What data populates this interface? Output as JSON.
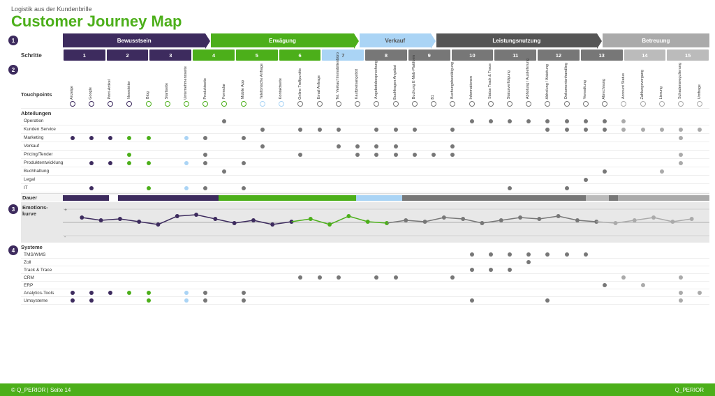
{
  "header": {
    "subtitle": "Logistik aus der Kundenbrille",
    "title": "Customer Journey Map"
  },
  "phases": [
    {
      "label": "Bewusstsein",
      "class": "phase-bewusstsein",
      "flex": 4
    },
    {
      "label": "Erwägung",
      "class": "phase-erwagung",
      "flex": 4
    },
    {
      "label": "Verkauf",
      "class": "phase-verkauf",
      "flex": 2
    },
    {
      "label": "Leistungsnutzung",
      "class": "phase-leistung",
      "flex": 4
    },
    {
      "label": "Betreuung",
      "class": "phase-betreuung",
      "flex": 3
    }
  ],
  "steps": [
    {
      "num": "1",
      "class": "step-dark"
    },
    {
      "num": "2",
      "class": "step-dark"
    },
    {
      "num": "3",
      "class": "step-dark"
    },
    {
      "num": "4",
      "class": "step-green"
    },
    {
      "num": "5",
      "class": "step-green"
    },
    {
      "num": "6",
      "class": "step-green"
    },
    {
      "num": "7",
      "class": "step-lightblue"
    },
    {
      "num": "8",
      "class": "step-gray"
    },
    {
      "num": "9",
      "class": "step-gray"
    },
    {
      "num": "10",
      "class": "step-gray"
    },
    {
      "num": "11",
      "class": "step-gray"
    },
    {
      "num": "12",
      "class": "step-gray"
    },
    {
      "num": "13",
      "class": "step-gray"
    },
    {
      "num": "14",
      "class": "step-lightgray"
    },
    {
      "num": "15",
      "class": "step-lightgray"
    }
  ],
  "touchpoints": [
    "Anzeige",
    "Google",
    "Print-Artikel",
    "Newsletter",
    "Blog",
    "Startseite",
    "Unternehmensseite",
    "Produktseite",
    "Formular",
    "Mobile App",
    "Telefonische Anfrage",
    "Kontaktseite",
    "Online Treffpunkte",
    "Email Anfrage",
    "Tel. Verkauf Immobilienbüro",
    "Kaufpreisangebot",
    "Angebotsbesprechung",
    "Buchfragen Angebot",
    "Buchung E-Mob-Plattform",
    "B1",
    "Buchungsbestätigung",
    "Informationen",
    "Status Track & Trace",
    "Statusverfolgung",
    "Abholung / Auslieferung",
    "Abholung / Ableitung",
    "Dokumentenhandling",
    "Verwaltung",
    "Abrechnung",
    "Account Status",
    "Zahlungsvorgang",
    "Lierung",
    "Schadensregulierung",
    "Umfrage"
  ],
  "abteilungen": [
    {
      "label": "Operation",
      "dots": [
        0,
        0,
        0,
        0,
        0,
        0,
        0,
        0,
        1,
        0,
        0,
        0,
        0,
        0,
        0,
        0,
        0,
        0,
        0,
        0,
        0,
        1,
        1,
        1,
        1,
        1,
        1,
        1,
        1,
        1,
        0,
        0,
        0,
        0
      ],
      "color": "green"
    },
    {
      "label": "Kunden Service",
      "dots": [
        0,
        0,
        0,
        0,
        0,
        0,
        0,
        0,
        0,
        0,
        1,
        0,
        1,
        1,
        1,
        0,
        1,
        1,
        1,
        0,
        1,
        0,
        0,
        0,
        0,
        1,
        1,
        1,
        1,
        1,
        1,
        1,
        1,
        1
      ],
      "color": "blue"
    },
    {
      "label": "Marketing",
      "dots": [
        1,
        1,
        1,
        1,
        1,
        0,
        1,
        1,
        0,
        1,
        0,
        0,
        0,
        0,
        0,
        0,
        0,
        0,
        0,
        0,
        0,
        0,
        0,
        0,
        0,
        0,
        0,
        0,
        0,
        0,
        0,
        0,
        1,
        0
      ],
      "color": "dark"
    },
    {
      "label": "Verkauf",
      "dots": [
        0,
        0,
        0,
        0,
        0,
        0,
        0,
        0,
        0,
        0,
        1,
        0,
        0,
        0,
        1,
        1,
        1,
        1,
        0,
        0,
        1,
        0,
        0,
        0,
        0,
        0,
        0,
        0,
        0,
        0,
        0,
        0,
        0,
        0
      ],
      "color": "green"
    },
    {
      "label": "Pricing/Tender",
      "dots": [
        0,
        0,
        0,
        1,
        0,
        0,
        0,
        1,
        0,
        0,
        0,
        0,
        1,
        0,
        0,
        1,
        1,
        1,
        1,
        1,
        1,
        0,
        0,
        0,
        0,
        0,
        0,
        0,
        0,
        0,
        0,
        0,
        1,
        0
      ],
      "color": "blue"
    },
    {
      "label": "Produktentwicklung",
      "dots": [
        0,
        1,
        1,
        1,
        1,
        0,
        1,
        1,
        0,
        1,
        0,
        0,
        0,
        0,
        0,
        0,
        0,
        0,
        0,
        0,
        0,
        0,
        0,
        0,
        0,
        0,
        0,
        0,
        0,
        0,
        0,
        0,
        1,
        0
      ],
      "color": "dark"
    },
    {
      "label": "Buchhaltung",
      "dots": [
        0,
        0,
        0,
        0,
        0,
        0,
        0,
        0,
        1,
        0,
        0,
        0,
        0,
        0,
        0,
        0,
        0,
        0,
        0,
        0,
        0,
        0,
        0,
        0,
        0,
        0,
        0,
        0,
        1,
        0,
        0,
        1,
        0,
        0
      ],
      "color": "gray"
    },
    {
      "label": "Legal",
      "dots": [
        0,
        0,
        0,
        0,
        0,
        0,
        0,
        0,
        0,
        0,
        0,
        0,
        0,
        0,
        0,
        0,
        0,
        0,
        0,
        0,
        0,
        0,
        0,
        0,
        0,
        0,
        0,
        1,
        0,
        0,
        0,
        0,
        0,
        0
      ],
      "color": "gray"
    },
    {
      "label": "IT",
      "dots": [
        0,
        1,
        0,
        0,
        1,
        0,
        1,
        1,
        0,
        1,
        0,
        0,
        0,
        0,
        0,
        0,
        0,
        0,
        0,
        0,
        0,
        0,
        0,
        1,
        0,
        0,
        1,
        0,
        0,
        0,
        0,
        0,
        0,
        0
      ],
      "color": "dark"
    }
  ],
  "systeme": [
    {
      "label": "TMS/WMS",
      "dots": [
        0,
        0,
        0,
        0,
        0,
        0,
        0,
        0,
        0,
        0,
        0,
        0,
        0,
        0,
        0,
        0,
        0,
        0,
        0,
        0,
        0,
        1,
        1,
        1,
        1,
        1,
        1,
        1,
        0,
        0,
        0,
        0,
        0,
        0
      ]
    },
    {
      "label": "Zoll",
      "dots": [
        0,
        0,
        0,
        0,
        0,
        0,
        0,
        0,
        0,
        0,
        0,
        0,
        0,
        0,
        0,
        0,
        0,
        0,
        0,
        0,
        0,
        0,
        0,
        0,
        1,
        0,
        0,
        0,
        0,
        0,
        0,
        0,
        0,
        0
      ]
    },
    {
      "label": "Track & Trace",
      "dots": [
        0,
        0,
        0,
        0,
        0,
        0,
        0,
        0,
        0,
        0,
        0,
        0,
        0,
        0,
        0,
        0,
        0,
        0,
        0,
        0,
        0,
        1,
        1,
        1,
        0,
        0,
        0,
        0,
        0,
        0,
        0,
        0,
        0,
        0
      ]
    },
    {
      "label": "CRM",
      "dots": [
        0,
        0,
        0,
        0,
        0,
        0,
        0,
        0,
        0,
        0,
        0,
        0,
        1,
        1,
        1,
        0,
        1,
        1,
        0,
        0,
        1,
        0,
        0,
        0,
        0,
        0,
        0,
        0,
        0,
        1,
        0,
        0,
        1,
        0
      ]
    },
    {
      "label": "ERP",
      "dots": [
        0,
        0,
        0,
        0,
        0,
        0,
        0,
        0,
        0,
        0,
        0,
        0,
        0,
        0,
        0,
        0,
        0,
        0,
        0,
        0,
        0,
        0,
        0,
        0,
        0,
        0,
        0,
        0,
        1,
        0,
        1,
        0,
        0,
        0
      ]
    },
    {
      "label": "Analytics-Tools",
      "dots": [
        1,
        1,
        1,
        1,
        1,
        0,
        1,
        1,
        0,
        1,
        0,
        0,
        0,
        0,
        0,
        0,
        0,
        0,
        0,
        0,
        0,
        0,
        0,
        0,
        0,
        0,
        0,
        0,
        0,
        0,
        0,
        0,
        1,
        1
      ]
    },
    {
      "label": "Umsysteme",
      "dots": [
        1,
        1,
        0,
        0,
        1,
        0,
        1,
        1,
        0,
        1,
        0,
        0,
        0,
        0,
        0,
        0,
        0,
        0,
        0,
        0,
        0,
        1,
        0,
        0,
        0,
        1,
        0,
        0,
        0,
        0,
        0,
        0,
        1,
        0
      ]
    }
  ],
  "footer": {
    "copyright": "© Q_PERIOR | Seite 14",
    "brand": "Q_PERIOR"
  }
}
